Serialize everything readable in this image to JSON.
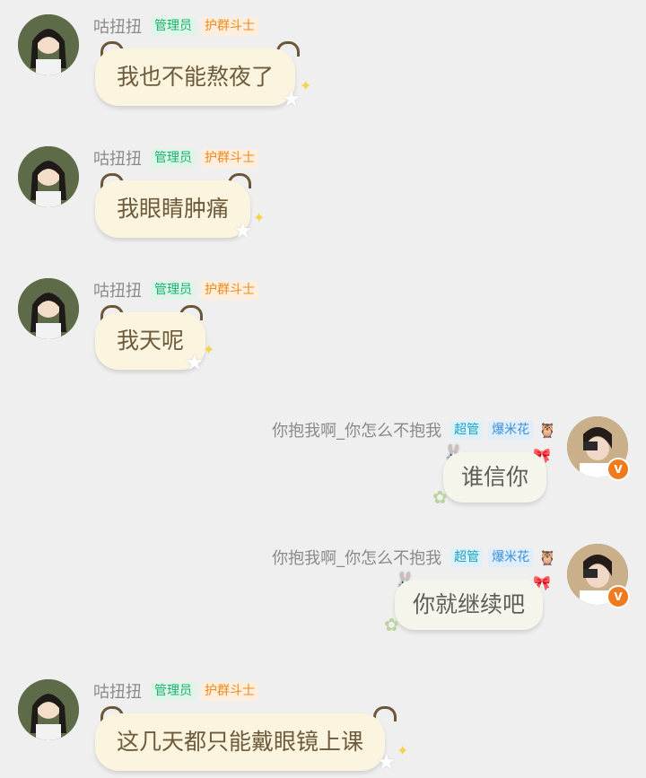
{
  "messages": [
    {
      "side": "left",
      "nickname": "咕扭扭",
      "badges": [
        "管理员",
        "护群斗士"
      ],
      "text": "我也不能熬夜了"
    },
    {
      "side": "left",
      "nickname": "咕扭扭",
      "badges": [
        "管理员",
        "护群斗士"
      ],
      "text": "我眼睛肿痛"
    },
    {
      "side": "left",
      "nickname": "咕扭扭",
      "badges": [
        "管理员",
        "护群斗士"
      ],
      "text": "我天呢"
    },
    {
      "side": "right",
      "nickname": "你抱我啊_你怎么不抱我",
      "badges": [
        "超管",
        "爆米花"
      ],
      "text": "谁信你"
    },
    {
      "side": "right",
      "nickname": "你抱我啊_你怎么不抱我",
      "badges": [
        "超管",
        "爆米花"
      ],
      "text": "你就继续吧"
    },
    {
      "side": "left",
      "nickname": "咕扭扭",
      "badges": [
        "管理员",
        "护群斗士"
      ],
      "text": "这几天都只能戴眼镜上课"
    }
  ],
  "icons": {
    "owl": "owl-badge-icon",
    "verified": "verified-v-icon"
  },
  "colors": {
    "admin": "#18b36a",
    "guard": "#f0891a",
    "super": "#19a3c9",
    "pop": "#3a8fd8",
    "left_bubble": "#fbf4df",
    "right_bubble": "#f6f5ec"
  }
}
